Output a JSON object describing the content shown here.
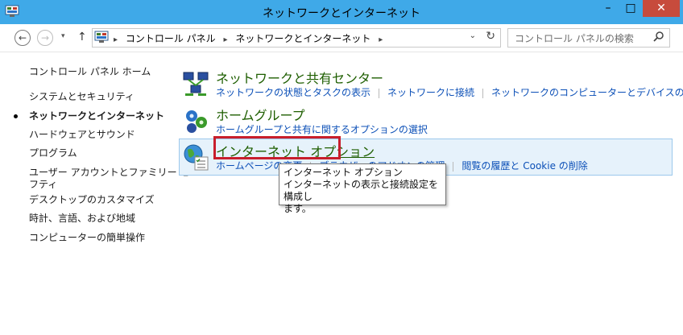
{
  "window": {
    "title": "ネットワークとインターネット",
    "minimize_label": "–",
    "maximize_label": "□",
    "close_label": "✕"
  },
  "nav": {
    "back_glyph": "←",
    "forward_glyph": "→",
    "recent_glyph": "▾",
    "up_glyph": "↑",
    "breadcrumb": [
      "コントロール パネル",
      "ネットワークとインターネット"
    ],
    "breadcrumb_separator": "▸",
    "address_dropdown_glyph": "⌄",
    "refresh_glyph": "↻",
    "search_placeholder": "コントロール パネルの検索"
  },
  "sidebar": {
    "items": [
      {
        "label": "コントロール パネル ホーム",
        "current": false
      },
      {
        "label": "システムとセキュリティ",
        "current": false
      },
      {
        "label": "ネットワークとインターネット",
        "current": true
      },
      {
        "label": "ハードウェアとサウンド",
        "current": false
      },
      {
        "label": "プログラム",
        "current": false
      },
      {
        "label": "ユーザー アカウントとファミリー セー",
        "current": false
      },
      {
        "label": "フティ",
        "current": false
      },
      {
        "label": "デスクトップのカスタマイズ",
        "current": false
      },
      {
        "label": "時計、言語、および地域",
        "current": false
      },
      {
        "label": "コンピューターの簡単操作",
        "current": false
      }
    ]
  },
  "sections": [
    {
      "heading": "ネットワークと共有センター",
      "icon": "network-sharing-icon",
      "links": [
        "ネットワークの状態とタスクの表示",
        "ネットワークに接続",
        "ネットワークのコンピューターとデバイスの表示"
      ]
    },
    {
      "heading": "ホームグループ",
      "icon": "homegroup-icon",
      "links": [
        "ホームグループと共有に関するオプションの選択"
      ]
    },
    {
      "heading": "インターネット オプション",
      "icon": "internet-options-icon",
      "links": [
        "ホームページの変更",
        "ブラウザーのアドオンの管理",
        "閲覧の履歴と Cookie の削除"
      ]
    }
  ],
  "tooltip": {
    "title": "インターネット オプション",
    "line1": "インターネットの表示と接続設定を構成し",
    "line2": "ます。"
  },
  "colors": {
    "titlebar": "#3fa9e8",
    "close_button": "#c74b3c",
    "heading_green": "#1e5e00",
    "link_blue": "#0b4fb7",
    "highlight_bg": "#e6f2fb",
    "annotation_red": "#c81e2c"
  }
}
